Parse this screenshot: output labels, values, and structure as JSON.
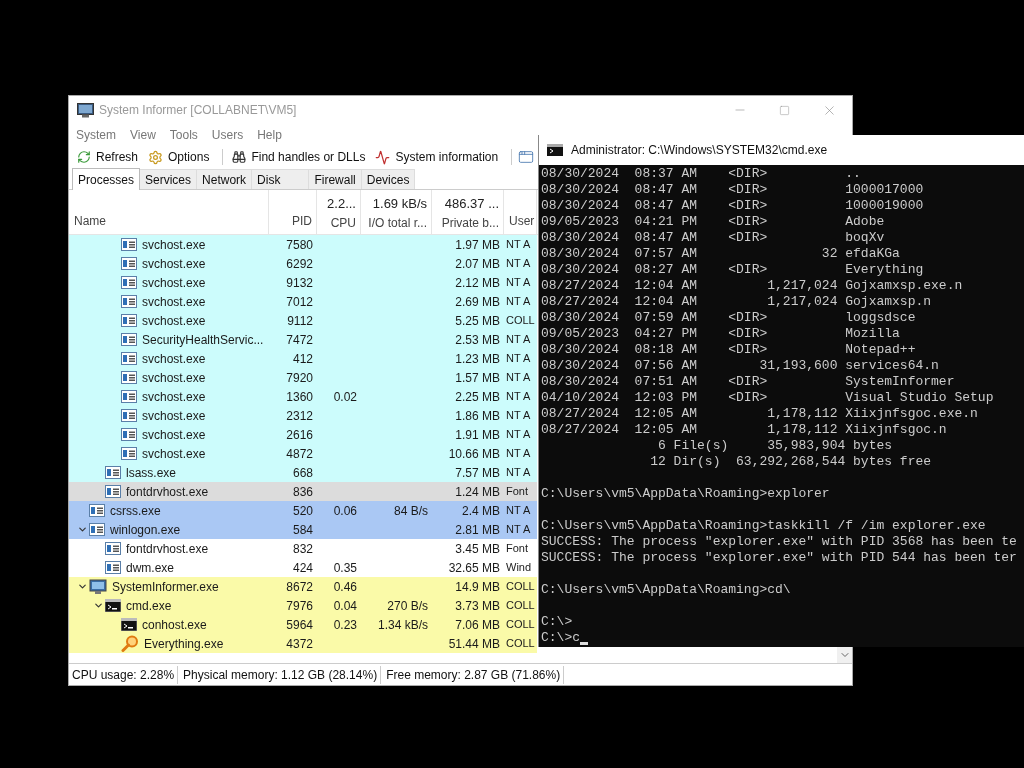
{
  "system_informer": {
    "title": "System Informer [COLLABNET\\VM5]",
    "menu": [
      "System",
      "View",
      "Tools",
      "Users",
      "Help"
    ],
    "toolbar": [
      {
        "label": "Refresh",
        "kind": "refresh"
      },
      {
        "label": "Options",
        "kind": "options"
      },
      {
        "label": "Find handles or DLLs",
        "kind": "find"
      },
      {
        "label": "System information",
        "kind": "sysinfo"
      }
    ],
    "tabs": [
      {
        "label": "Processes",
        "selected": true
      },
      {
        "label": "Services",
        "selected": false
      },
      {
        "label": "Network",
        "selected": false
      },
      {
        "label": "Disk",
        "selected": false
      },
      {
        "label": "Firewall",
        "selected": false
      },
      {
        "label": "Devices",
        "selected": false
      }
    ],
    "columns": [
      {
        "label": "Name"
      },
      {
        "label": "PID"
      },
      {
        "label": "CPU",
        "total": "2.2..."
      },
      {
        "label": "I/O total r...",
        "total": "1.69 kB/s"
      },
      {
        "label": "Private b...",
        "total": "486.37 ..."
      },
      {
        "label": "User"
      }
    ],
    "processes": [
      {
        "children": [
          {
            "children": [
              {
                "name": "svchost.exe",
                "pid": "7580",
                "private": "1.97 MB",
                "user": "NT A",
                "color": "#ccfcfc",
                "kind": "service",
                "expanded": false
              },
              {
                "name": "svchost.exe",
                "pid": "6292",
                "private": "2.07 MB",
                "user": "NT A",
                "color": "#ccfcfc",
                "kind": "service",
                "expanded": false
              },
              {
                "name": "svchost.exe",
                "pid": "9132",
                "private": "2.12 MB",
                "user": "NT A",
                "color": "#ccfcfc",
                "kind": "service",
                "expanded": false
              },
              {
                "name": "svchost.exe",
                "pid": "7012",
                "private": "2.69 MB",
                "user": "NT A",
                "color": "#ccfcfc",
                "kind": "service",
                "expanded": false
              },
              {
                "name": "svchost.exe",
                "pid": "9112",
                "private": "5.25 MB",
                "user": "COLL",
                "color": "#ccfcfc",
                "kind": "service",
                "expanded": false
              },
              {
                "name": "SecurityHealthServic...",
                "pid": "7472",
                "private": "2.53 MB",
                "user": "NT A",
                "color": "#ccfcfc",
                "kind": "service",
                "expanded": false
              },
              {
                "name": "svchost.exe",
                "pid": "412",
                "private": "1.23 MB",
                "user": "NT A",
                "color": "#ccfcfc",
                "kind": "service",
                "expanded": false
              },
              {
                "name": "svchost.exe",
                "pid": "7920",
                "private": "1.57 MB",
                "user": "NT A",
                "color": "#ccfcfc",
                "kind": "service",
                "expanded": false
              },
              {
                "name": "svchost.exe",
                "pid": "1360",
                "cpu": "0.02",
                "private": "2.25 MB",
                "user": "NT A",
                "color": "#ccfcfc",
                "kind": "service",
                "expanded": false
              },
              {
                "name": "svchost.exe",
                "pid": "2312",
                "private": "1.86 MB",
                "user": "NT A",
                "color": "#ccfcfc",
                "kind": "service",
                "expanded": false
              },
              {
                "name": "svchost.exe",
                "pid": "2616",
                "private": "1.91 MB",
                "user": "NT A",
                "color": "#ccfcfc",
                "kind": "service",
                "expanded": false
              },
              {
                "name": "svchost.exe",
                "pid": "4872",
                "private": "10.66 MB",
                "user": "NT A",
                "color": "#ccfcfc",
                "kind": "service",
                "expanded": false
              }
            ]
          },
          {
            "name": "lsass.exe",
            "pid": "668",
            "private": "7.57 MB",
            "user": "NT A",
            "color": "#ccfcfc",
            "kind": "service",
            "expanded": false
          },
          {
            "name": "fontdrvhost.exe",
            "pid": "836",
            "private": "1.24 MB",
            "user": "Font",
            "color": "#dcdcdc",
            "kind": "service",
            "expanded": false
          }
        ]
      },
      {
        "name": "csrss.exe",
        "pid": "520",
        "cpu": "0.06",
        "io": "84 B/s",
        "private": "2.4 MB",
        "user": "NT A",
        "color": "#aac8f4",
        "kind": "service",
        "expanded": false
      },
      {
        "name": "winlogon.exe",
        "pid": "584",
        "private": "2.81 MB",
        "user": "NT A",
        "color": "#aac8f4",
        "kind": "service",
        "expanded": true,
        "children": [
          {
            "name": "fontdrvhost.exe",
            "pid": "832",
            "private": "3.45 MB",
            "user": "Font",
            "color": "#ffffff",
            "kind": "service",
            "expanded": false
          },
          {
            "name": "dwm.exe",
            "pid": "424",
            "cpu": "0.35",
            "private": "32.65 MB",
            "user": "Wind",
            "color": "#ffffff",
            "kind": "service",
            "expanded": false
          }
        ]
      },
      {
        "name": "SystemInformer.exe",
        "pid": "8672",
        "cpu": "0.46",
        "private": "14.9 MB",
        "user": "COLL",
        "color": "#fafaa8",
        "kind": "monitor",
        "expanded": true,
        "children": [
          {
            "name": "cmd.exe",
            "pid": "7976",
            "cpu": "0.04",
            "io": "270 B/s",
            "private": "3.73 MB",
            "user": "COLL",
            "color": "#fafaa8",
            "kind": "console",
            "expanded": true,
            "children": [
              {
                "name": "conhost.exe",
                "pid": "5964",
                "cpu": "0.23",
                "io": "1.34 kB/s",
                "private": "7.06 MB",
                "user": "COLL",
                "color": "#fafaa8",
                "kind": "console",
                "expanded": false
              },
              {
                "name": "Everything.exe",
                "pid": "4372",
                "private": "51.44 MB",
                "user": "COLL",
                "color": "#fafaa8",
                "kind": "search",
                "expanded": false
              }
            ]
          }
        ]
      }
    ],
    "status_bar": [
      "CPU usage: 2.28%",
      "Physical memory: 1.12 GB (28.14%)",
      "Free memory: 2.87 GB (71.86%)"
    ]
  },
  "console": {
    "title": "Administrator: C:\\Windows\\SYSTEM32\\cmd.exe",
    "blocks": [
      [
        "08/30/2024  08:37 AM    <DIR>          ..",
        "08/30/2024  08:47 AM    <DIR>          1000017000",
        "08/30/2024  08:47 AM    <DIR>          1000019000",
        "09/05/2023  04:21 PM    <DIR>          Adobe",
        "08/30/2024  08:47 AM    <DIR>          boqXv",
        "08/30/2024  07:57 AM                32 efdaKGa",
        "08/30/2024  08:27 AM    <DIR>          Everything",
        "08/27/2024  12:04 AM         1,217,024 Gojxamxsp.exe.n",
        "08/27/2024  12:04 AM         1,217,024 Gojxamxsp.n",
        "08/30/2024  07:59 AM    <DIR>          loggsdsce",
        "09/05/2023  04:27 PM    <DIR>          Mozilla",
        "08/30/2024  08:18 AM    <DIR>          Notepad++",
        "08/30/2024  07:56 AM        31,193,600 services64.n",
        "08/30/2024  07:51 AM    <DIR>          SystemInformer",
        "04/10/2024  12:03 PM    <DIR>          Visual Studio Setup",
        "08/27/2024  12:05 AM         1,178,112 Xiixjnfsgoc.exe.n",
        "08/27/2024  12:05 AM         1,178,112 Xiixjnfsgoc.n",
        "               6 File(s)     35,983,904 bytes",
        "              12 Dir(s)  63,292,268,544 bytes free"
      ],
      [
        "C:\\Users\\vm5\\AppData\\Roaming>explorer"
      ],
      [
        "C:\\Users\\vm5\\AppData\\Roaming>taskkill /f /im explorer.exe",
        "SUCCESS: The process \"explorer.exe\" with PID 3568 has been te",
        "SUCCESS: The process \"explorer.exe\" with PID 544 has been ter"
      ],
      [
        "C:\\Users\\vm5\\AppData\\Roaming>cd\\"
      ],
      [
        "C:\\>",
        "C:\\>c"
      ]
    ],
    "cursor": true
  }
}
